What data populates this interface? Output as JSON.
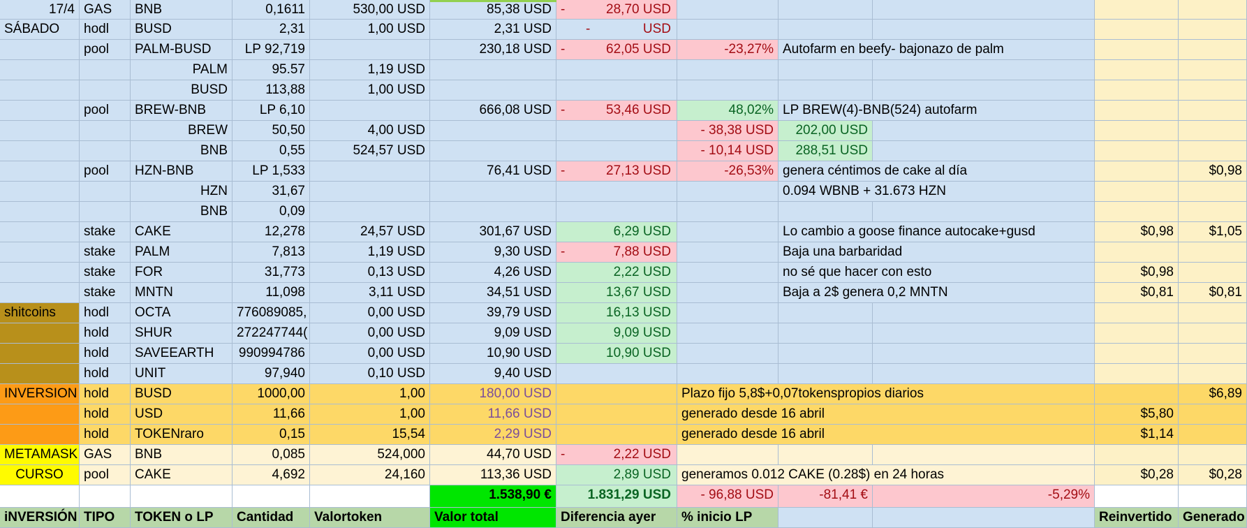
{
  "colors": {
    "blue": "#cfe1f3",
    "sand": "#fdf1c6",
    "olive": "#b8901b",
    "orange_hi": "#fd9b16",
    "orange": "#fdd867",
    "yellow": "#fffb00",
    "cream": "#fef3d4",
    "pink": "#fdc7ce",
    "red_text": "#a30d14",
    "green": "#c6efce",
    "green_text": "#0a6423",
    "green_bright": "#00e600",
    "green_mid": "#92d050",
    "header_green": "#b7d7a8",
    "purple_text": "#7b4e9b",
    "white": "#ffffff"
  },
  "rows": [
    [
      "17/4",
      "GAS",
      "BNB",
      "0,1611",
      "530,00 USD",
      "85,38 USD",
      "-",
      "28,70 USD",
      "",
      "",
      "",
      "",
      ""
    ],
    [
      "SÁBADO",
      "hodl",
      "BUSD",
      "2,31",
      "1,00 USD",
      "2,31 USD",
      "-",
      "USD",
      "",
      "",
      "",
      "",
      ""
    ],
    [
      "",
      "pool",
      "PALM-BUSD",
      "LP 92,719",
      "",
      "230,18 USD",
      "-",
      "62,05 USD",
      "-23,27%",
      "Autofarm en beefy- bajonazo de palm",
      "",
      "",
      ""
    ],
    [
      "",
      "",
      "PALM",
      "95.57",
      "1,19 USD",
      "",
      "",
      "",
      "",
      "",
      "",
      "",
      ""
    ],
    [
      "",
      "",
      "BUSD",
      "113,88",
      "1,00 USD",
      "",
      "",
      "",
      "",
      "",
      "",
      "",
      ""
    ],
    [
      "",
      "pool",
      "BREW-BNB",
      "LP 6,10",
      "",
      "666,08 USD",
      "-",
      "53,46 USD",
      "48,02%",
      "LP BREW(4)-BNB(524) autofarm",
      "",
      "",
      ""
    ],
    [
      "",
      "",
      "BREW",
      "50,50",
      "4,00 USD",
      "",
      "",
      "",
      "- 38,38 USD",
      "202,00 USD",
      "",
      "",
      ""
    ],
    [
      "",
      "",
      "BNB",
      "0,55",
      "524,57 USD",
      "",
      "",
      "",
      "- 10,14 USD",
      "288,51 USD",
      "",
      "",
      ""
    ],
    [
      "",
      "pool",
      "HZN-BNB",
      "LP 1,533",
      "",
      "76,41 USD",
      "-",
      "27,13 USD",
      "-26,53%",
      "genera céntimos de cake al día",
      "",
      "",
      "$0,98"
    ],
    [
      "",
      "",
      "HZN",
      "31,67",
      "",
      "",
      "",
      "",
      "",
      "0.094 WBNB + 31.673 HZN",
      "",
      "",
      ""
    ],
    [
      "",
      "",
      "BNB",
      "0,09",
      "",
      "",
      "",
      "",
      "",
      "",
      "",
      "",
      ""
    ],
    [
      "",
      "stake",
      "CAKE",
      "12,278",
      "24,57 USD",
      "301,67 USD",
      "",
      "6,29 USD",
      "",
      "Lo cambio a goose finance autocake+gusd",
      "",
      "$0,98",
      "$1,05"
    ],
    [
      "",
      "stake",
      "PALM",
      "7,813",
      "1,19 USD",
      "9,30 USD",
      "-",
      "7,88 USD",
      "",
      "Baja una barbaridad",
      "",
      "",
      ""
    ],
    [
      "",
      "stake",
      "FOR",
      "31,773",
      "0,13 USD",
      "4,26 USD",
      "",
      "2,22 USD",
      "",
      "no sé que hacer con esto",
      "",
      "$0,98",
      ""
    ],
    [
      "",
      "stake",
      "MNTN",
      "11,098",
      "3,11 USD",
      "34,51 USD",
      "",
      "13,67 USD",
      "",
      "Baja a 2$ genera 0,2 MNTN",
      "",
      "$0,81",
      "$0,81"
    ],
    [
      "shitcoins",
      "hodl",
      "OCTA",
      "776089085,",
      "0,00 USD",
      "39,79 USD",
      "",
      "16,13 USD",
      "",
      "",
      "",
      "",
      ""
    ],
    [
      "",
      "hold",
      "SHUR",
      "272247744(",
      "0,00 USD",
      "9,09 USD",
      "",
      "9,09 USD",
      "",
      "",
      "",
      "",
      ""
    ],
    [
      "",
      "hold",
      "SAVEEARTH",
      "990994786",
      "0,00 USD",
      "10,90 USD",
      "",
      "10,90 USD",
      "",
      "",
      "",
      "",
      ""
    ],
    [
      "",
      "hold",
      "UNIT",
      "97,940",
      "0,10 USD",
      "9,40 USD",
      "",
      "",
      "",
      "",
      "",
      "",
      ""
    ],
    [
      "INVERSION",
      "hold",
      "BUSD",
      "1000,00",
      "1,00",
      "180,00 USD",
      "",
      "",
      "Plazo fijo 5,8$+0,07tokenspropios diarios",
      "",
      "",
      "",
      "$6,89"
    ],
    [
      "",
      "hold",
      "USD",
      "11,66",
      "1,00",
      "11,66 USD",
      "",
      "",
      "generado desde 16 abril",
      "",
      "",
      "$5,80",
      ""
    ],
    [
      "",
      "hold",
      "TOKENraro",
      "0,15",
      "15,54",
      "2,29 USD",
      "",
      "",
      "generado desde 16 abril",
      "",
      "",
      "$1,14",
      ""
    ],
    [
      "METAMASK",
      "GAS",
      "BNB",
      "0,085",
      "524,000",
      "44,70 USD",
      "-",
      "2,22 USD",
      "",
      "",
      "",
      "",
      ""
    ],
    [
      "CURSO",
      "pool",
      "CAKE",
      "4,692",
      "24,160",
      "113,36 USD",
      "",
      "2,89 USD",
      "generamos 0.012 CAKE (0.28$) en 24 horas",
      "",
      "",
      "$0,28",
      "$0,28"
    ],
    [
      "",
      "",
      "",
      "",
      "",
      "1.538,90 €",
      "",
      "1.831,29 USD",
      "- 96,88 USD",
      "-81,41 €",
      "-5,29%",
      "",
      ""
    ],
    [
      "iNVERSIÓN",
      "TIPO",
      "TOKEN o LP",
      "Cantidad",
      "Valortoken",
      "Valor total",
      "",
      "Diferencia ayer",
      "% inicio LP",
      "",
      "",
      "Reinvertido",
      "Generado"
    ]
  ]
}
